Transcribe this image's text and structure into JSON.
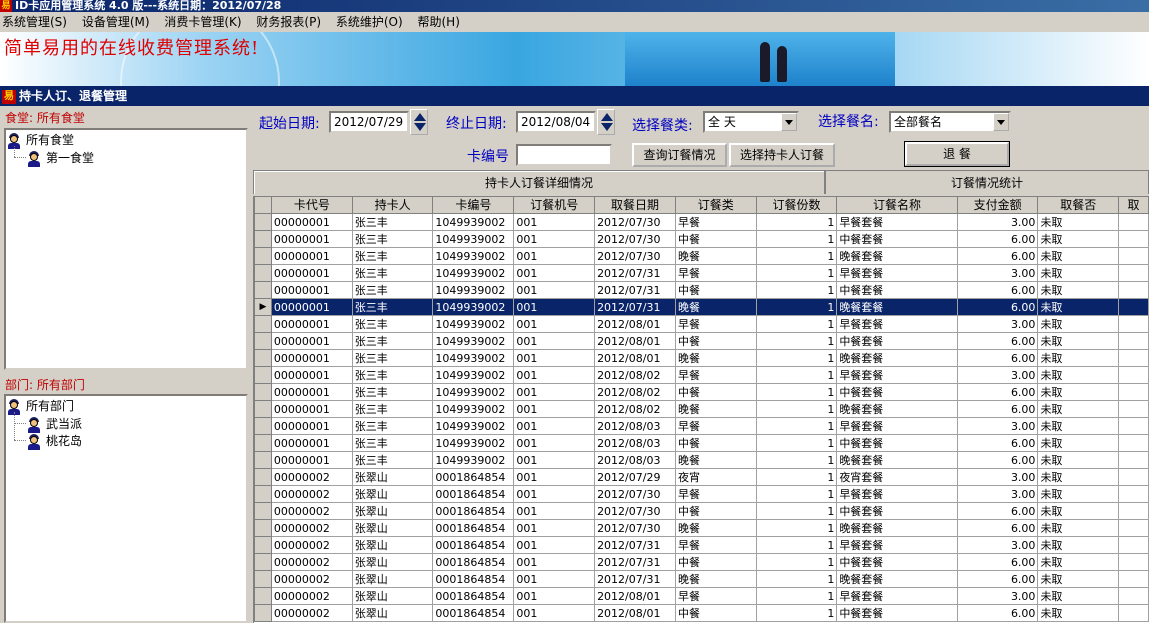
{
  "window": {
    "title": "ID卡应用管理系统 4.0 版---系统日期：2012/07/28",
    "logo_glyph": "易"
  },
  "menu": [
    "系统管理(S)",
    "设备管理(M)",
    "消费卡管理(K)",
    "财务报表(P)",
    "系统维护(O)",
    "帮助(H)"
  ],
  "banner": {
    "slogan": "简单易用的在线收费管理系统!"
  },
  "panel": {
    "title": "持卡人订、退餐管理",
    "icon_glyph": "易"
  },
  "left": {
    "canteen_label": "食堂: 所有食堂",
    "canteen_tree": {
      "root": "所有食堂",
      "children": [
        "第一食堂"
      ]
    },
    "dept_label": "部门: 所有部门",
    "dept_tree": {
      "root": "所有部门",
      "children": [
        "武当派",
        "桃花岛"
      ]
    }
  },
  "filters": {
    "start_label": "起始日期:",
    "start_value": "2012/07/29",
    "end_label": "终止日期:",
    "end_value": "2012/08/04",
    "meal_type_label": "选择餐类:",
    "meal_type_value": "全 天",
    "meal_name_label": "选择餐名:",
    "meal_name_value": "全部餐名",
    "card_no_label": "卡编号",
    "card_no_value": ""
  },
  "buttons": {
    "query": "查询订餐情况",
    "select_holder": "选择持卡人订餐",
    "cancel": "退 餐"
  },
  "tabs": [
    "持卡人订餐详细情况",
    "订餐情况统计"
  ],
  "table": {
    "columns": [
      "卡代号",
      "持卡人",
      "卡编号",
      "订餐机号",
      "取餐日期",
      "订餐类",
      "订餐份数",
      "订餐名称",
      "支付金额",
      "取餐否",
      "取"
    ],
    "selected_row": 5,
    "rows": [
      [
        "00000001",
        "张三丰",
        "1049939002",
        "001",
        "2012/07/30",
        "早餐",
        "1",
        "早餐套餐",
        "3.00",
        "未取"
      ],
      [
        "00000001",
        "张三丰",
        "1049939002",
        "001",
        "2012/07/30",
        "中餐",
        "1",
        "中餐套餐",
        "6.00",
        "未取"
      ],
      [
        "00000001",
        "张三丰",
        "1049939002",
        "001",
        "2012/07/30",
        "晚餐",
        "1",
        "晚餐套餐",
        "6.00",
        "未取"
      ],
      [
        "00000001",
        "张三丰",
        "1049939002",
        "001",
        "2012/07/31",
        "早餐",
        "1",
        "早餐套餐",
        "3.00",
        "未取"
      ],
      [
        "00000001",
        "张三丰",
        "1049939002",
        "001",
        "2012/07/31",
        "中餐",
        "1",
        "中餐套餐",
        "6.00",
        "未取"
      ],
      [
        "00000001",
        "张三丰",
        "1049939002",
        "001",
        "2012/07/31",
        "晚餐",
        "1",
        "晚餐套餐",
        "6.00",
        "未取"
      ],
      [
        "00000001",
        "张三丰",
        "1049939002",
        "001",
        "2012/08/01",
        "早餐",
        "1",
        "早餐套餐",
        "3.00",
        "未取"
      ],
      [
        "00000001",
        "张三丰",
        "1049939002",
        "001",
        "2012/08/01",
        "中餐",
        "1",
        "中餐套餐",
        "6.00",
        "未取"
      ],
      [
        "00000001",
        "张三丰",
        "1049939002",
        "001",
        "2012/08/01",
        "晚餐",
        "1",
        "晚餐套餐",
        "6.00",
        "未取"
      ],
      [
        "00000001",
        "张三丰",
        "1049939002",
        "001",
        "2012/08/02",
        "早餐",
        "1",
        "早餐套餐",
        "3.00",
        "未取"
      ],
      [
        "00000001",
        "张三丰",
        "1049939002",
        "001",
        "2012/08/02",
        "中餐",
        "1",
        "中餐套餐",
        "6.00",
        "未取"
      ],
      [
        "00000001",
        "张三丰",
        "1049939002",
        "001",
        "2012/08/02",
        "晚餐",
        "1",
        "晚餐套餐",
        "6.00",
        "未取"
      ],
      [
        "00000001",
        "张三丰",
        "1049939002",
        "001",
        "2012/08/03",
        "早餐",
        "1",
        "早餐套餐",
        "3.00",
        "未取"
      ],
      [
        "00000001",
        "张三丰",
        "1049939002",
        "001",
        "2012/08/03",
        "中餐",
        "1",
        "中餐套餐",
        "6.00",
        "未取"
      ],
      [
        "00000001",
        "张三丰",
        "1049939002",
        "001",
        "2012/08/03",
        "晚餐",
        "1",
        "晚餐套餐",
        "6.00",
        "未取"
      ],
      [
        "00000002",
        "张翠山",
        "0001864854",
        "001",
        "2012/07/29",
        "夜宵",
        "1",
        "夜宵套餐",
        "3.00",
        "未取"
      ],
      [
        "00000002",
        "张翠山",
        "0001864854",
        "001",
        "2012/07/30",
        "早餐",
        "1",
        "早餐套餐",
        "3.00",
        "未取"
      ],
      [
        "00000002",
        "张翠山",
        "0001864854",
        "001",
        "2012/07/30",
        "中餐",
        "1",
        "中餐套餐",
        "6.00",
        "未取"
      ],
      [
        "00000002",
        "张翠山",
        "0001864854",
        "001",
        "2012/07/30",
        "晚餐",
        "1",
        "晚餐套餐",
        "6.00",
        "未取"
      ],
      [
        "00000002",
        "张翠山",
        "0001864854",
        "001",
        "2012/07/31",
        "早餐",
        "1",
        "早餐套餐",
        "3.00",
        "未取"
      ],
      [
        "00000002",
        "张翠山",
        "0001864854",
        "001",
        "2012/07/31",
        "中餐",
        "1",
        "中餐套餐",
        "6.00",
        "未取"
      ],
      [
        "00000002",
        "张翠山",
        "0001864854",
        "001",
        "2012/07/31",
        "晚餐",
        "1",
        "晚餐套餐",
        "6.00",
        "未取"
      ],
      [
        "00000002",
        "张翠山",
        "0001864854",
        "001",
        "2012/08/01",
        "早餐",
        "1",
        "早餐套餐",
        "3.00",
        "未取"
      ],
      [
        "00000002",
        "张翠山",
        "0001864854",
        "001",
        "2012/08/01",
        "中餐",
        "1",
        "中餐套餐",
        "6.00",
        "未取"
      ]
    ]
  },
  "colors": {
    "title_bar": "#0a246a",
    "selection": "#0a246a",
    "label_blue": "#0000c0",
    "section_red": "#c00000",
    "slogan_red": "#e00000",
    "face": "#d4d0c8"
  }
}
